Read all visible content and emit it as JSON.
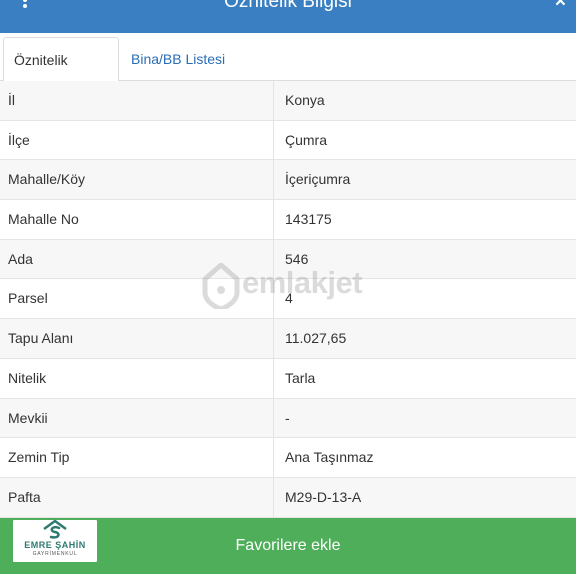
{
  "header": {
    "title": "Öznitelik Bilgisi",
    "close_label": "×"
  },
  "tabs": [
    {
      "label": "Öznitelik Bilgisi",
      "active": true
    },
    {
      "label": "Bina/BB Listesi",
      "active": false
    }
  ],
  "rows": [
    {
      "label": "İl",
      "value": "Konya"
    },
    {
      "label": "İlçe",
      "value": "Çumra"
    },
    {
      "label": "Mahalle/Köy",
      "value": "İçeriçumra"
    },
    {
      "label": "Mahalle No",
      "value": "143175"
    },
    {
      "label": "Ada",
      "value": "546"
    },
    {
      "label": "Parsel",
      "value": "4"
    },
    {
      "label": "Tapu Alanı",
      "value": "11.027,65"
    },
    {
      "label": "Nitelik",
      "value": "Tarla"
    },
    {
      "label": "Mevkii",
      "value": "-"
    },
    {
      "label": "Zemin Tip",
      "value": "Ana Taşınmaz"
    },
    {
      "label": "Pafta",
      "value": "M29-D-13-A"
    }
  ],
  "watermark": {
    "text": "emlakjet"
  },
  "footer": {
    "favorite_label": "Favorilere ekle",
    "logo_name": "EMRE ŞAHİN",
    "logo_sub": "GAYRİMENKUL"
  },
  "colors": {
    "header_bg": "#3a7fc1",
    "footer_bg": "#4fae5a",
    "link": "#2a6db5"
  }
}
